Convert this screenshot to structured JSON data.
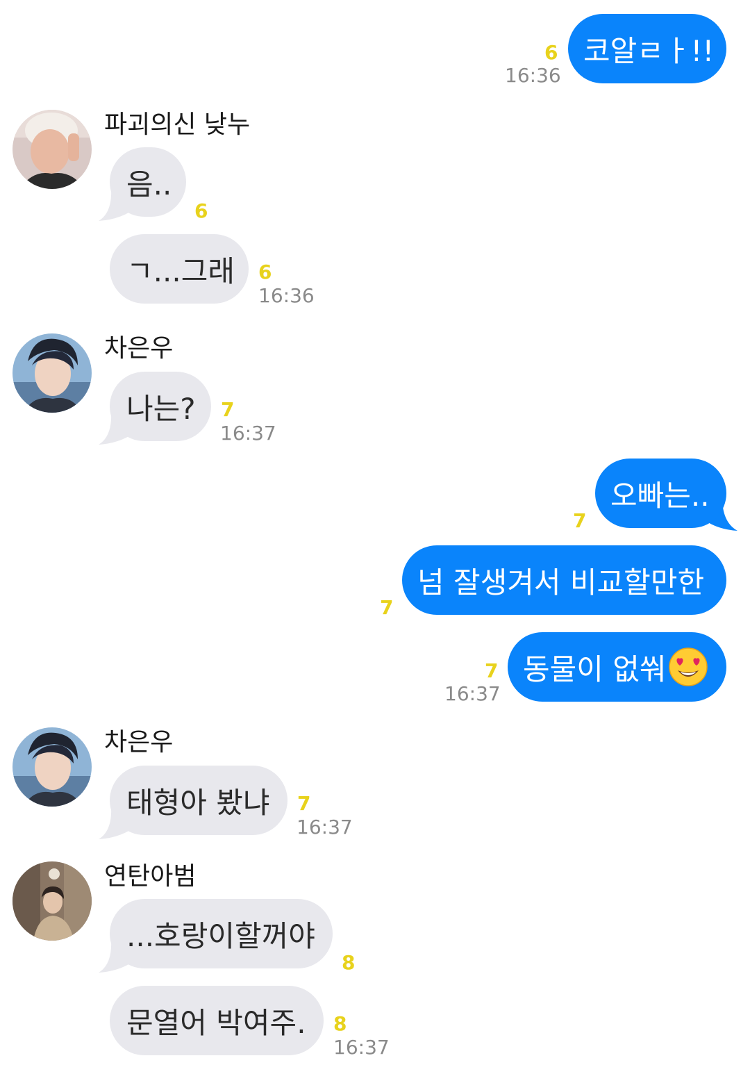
{
  "messages": {
    "m1": {
      "text": "코알ㄹㅏ!!",
      "read": "6",
      "time": "16:36"
    },
    "g1": {
      "sender": "파괴의신 낮누",
      "avatar_icon": "user-avatar-icon",
      "b1": {
        "text": "음..",
        "read": "6"
      },
      "b2": {
        "text": "ㄱ...그래",
        "read": "6",
        "time": "16:36"
      }
    },
    "g2": {
      "sender": "차은우",
      "avatar_icon": "user-avatar-icon",
      "b1": {
        "text": "나는?",
        "read": "7",
        "time": "16:37"
      }
    },
    "m2": {
      "b1": {
        "text": "오빠는..",
        "read": "7"
      },
      "b2": {
        "text": "넘 잘생겨서 비교할만한",
        "read": "7"
      },
      "b3": {
        "text": "동물이 없쒀",
        "emoji": "heart-eyes-emoji-icon",
        "read": "7",
        "time": "16:37"
      }
    },
    "g3": {
      "sender": "차은우",
      "avatar_icon": "user-avatar-icon",
      "b1": {
        "text": "태형아 봤냐",
        "read": "7",
        "time": "16:37"
      }
    },
    "g4": {
      "sender": "연탄아범",
      "avatar_icon": "user-avatar-icon",
      "b1": {
        "text": "...호랑이할꺼야",
        "read": "8"
      },
      "b2": {
        "text": "문열어 박여주.",
        "read": "8",
        "time": "16:37"
      }
    }
  },
  "colors": {
    "outgoing_bubble": "#0a84fb",
    "incoming_bubble": "#e8e8ed",
    "read_count": "#e8d21c",
    "timestamp": "#8a8a8a"
  }
}
